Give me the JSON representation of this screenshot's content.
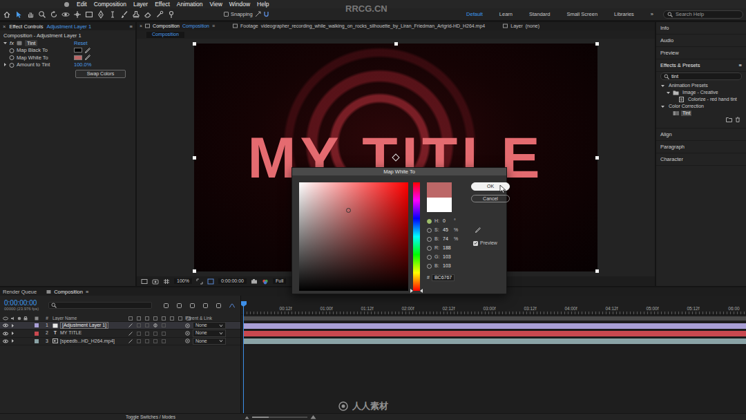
{
  "watermark": {
    "top": "RRCG.CN",
    "logo": "人人素材"
  },
  "menu": {
    "items": [
      "Edit",
      "Composition",
      "Layer",
      "Effect",
      "Animation",
      "View",
      "Window",
      "Help"
    ]
  },
  "toolbar": {
    "tools": [
      {
        "selected": false
      },
      {
        "selected": true
      },
      {
        "selected": false
      },
      {
        "selected": false
      },
      {
        "selected": false
      },
      {
        "selected": false
      },
      {
        "selected": false
      },
      {
        "selected": false
      },
      {
        "selected": false
      },
      {
        "selected": false
      },
      {
        "selected": false
      },
      {
        "selected": false
      },
      {
        "selected": false
      },
      {
        "selected": false
      },
      {
        "selected": false
      }
    ],
    "snapping": {
      "label": "Snapping",
      "checked": false
    },
    "workspaces": [
      {
        "label": "Default",
        "selected": true
      },
      {
        "label": "Learn",
        "selected": false
      },
      {
        "label": "Standard",
        "selected": false
      },
      {
        "label": "Small Screen",
        "selected": false
      },
      {
        "label": "Libraries",
        "selected": false
      }
    ],
    "overflow": "»",
    "search": {
      "placeholder": "Search Help"
    }
  },
  "effect_controls": {
    "tab": {
      "close": "×",
      "label": "Effect Controls",
      "layer": "Adjustment Layer 1",
      "menu": "≡"
    },
    "path": "Composition - Adjustment Layer 1",
    "effect": {
      "expanded": true,
      "fx": "fx",
      "name": "Tint",
      "reset": "Reset"
    },
    "params": [
      {
        "kind": "color",
        "label": "Map Black To",
        "color": "#000000"
      },
      {
        "kind": "color",
        "label": "Map White To",
        "color": "#bc6767"
      },
      {
        "kind": "value",
        "label": "Amount to Tint",
        "value": "100.0%",
        "expanded": false
      }
    ],
    "swap_button": "Swap Colors"
  },
  "composition": {
    "tabs": [
      {
        "label": "Composition",
        "name": "Composition",
        "selected": true,
        "close": "×",
        "menu": "≡"
      },
      {
        "label": "Footage",
        "name": "videographer_recording_while_walking_on_rocks_silhouette_by_Liran_Friedman_Artgrid-HD_H264.mp4",
        "selected": false
      },
      {
        "label": "Layer",
        "name": "(none)",
        "selected": false
      }
    ],
    "subtab": "Composition",
    "title_text": "MY TITLE",
    "viewer_bar": {
      "zoom": "100%",
      "time": "0:00:00:00",
      "resolution": "Full"
    }
  },
  "color_dialog": {
    "title": "Map White To",
    "ok": "OK",
    "cancel": "Cancel",
    "new_color": "#bc6767",
    "old_color": "#ffffff",
    "hue_color": "#ff0000",
    "saturation": 0.45,
    "brightness": 0.74,
    "hue_level": 0,
    "fields": [
      {
        "label": "H:",
        "value": "0",
        "unit": "°",
        "selected": true
      },
      {
        "label": "S:",
        "value": "45",
        "unit": "%",
        "selected": false
      },
      {
        "label": "B:",
        "value": "74",
        "unit": "%",
        "selected": false
      },
      {
        "label": "R:",
        "value": "188",
        "selected": false
      },
      {
        "label": "G:",
        "value": "103",
        "selected": false
      },
      {
        "label": "B:",
        "value": "103",
        "selected": false
      }
    ],
    "hex": {
      "label": "#",
      "value": "BC6767"
    },
    "preview": {
      "label": "Preview",
      "checked": true
    }
  },
  "side_panels": {
    "top": [
      "Info",
      "Audio",
      "Preview"
    ],
    "effects": {
      "title": "Effects & Presets",
      "menu": "≡",
      "search": "tint",
      "tree": [
        {
          "label": "Animation Presets",
          "kind": "group",
          "depth": 0,
          "expanded": true,
          "selected": false
        },
        {
          "label": "Image - Creative",
          "kind": "folder",
          "depth": 1,
          "expanded": true,
          "selected": false
        },
        {
          "label": "Colorize - red hand tint",
          "kind": "preset",
          "depth": 2,
          "expanded": false,
          "selected": false
        },
        {
          "label": "Color Correction",
          "kind": "group",
          "depth": 0,
          "expanded": true,
          "selected": false
        },
        {
          "label": "Tint",
          "kind": "effect",
          "depth": 1,
          "expanded": false,
          "selected": true
        }
      ]
    },
    "bottom": [
      "Align",
      "Paragraph",
      "Character"
    ]
  },
  "timeline": {
    "tabs": [
      {
        "label": "Render Queue",
        "selected": false
      },
      {
        "label": "Composition",
        "selected": true,
        "menu": "≡"
      }
    ],
    "timecode": "0:00:00:00",
    "frame_info": "00000 (23.976 fps)",
    "columns": {
      "number": "#",
      "name": "Layer Name",
      "parent": "Parent & Link"
    },
    "layers": [
      {
        "number": "1",
        "name": "[Adjustment Layer 1]",
        "kind": "adjustment",
        "color": "#a99fd6",
        "selected": true,
        "visible": true,
        "parent": "None"
      },
      {
        "number": "2",
        "name": "MY TITLE",
        "kind": "text",
        "glyph": "T",
        "color": "#c9484f",
        "selected": false,
        "visible": true,
        "parent": "None"
      },
      {
        "number": "3",
        "name": "[speedb...HD_H264.mp4]",
        "kind": "footage",
        "color": "#8aa3a6",
        "selected": false,
        "visible": true,
        "parent": "None"
      }
    ],
    "ruler": [
      "00:12f",
      "01:00f",
      "01:12f",
      "02:00f",
      "02:12f",
      "03:00f",
      "03:12f",
      "04:00f",
      "04:12f",
      "05:00f",
      "05:12f",
      "06:00"
    ],
    "playhead": 0,
    "zoom_level": 0.3,
    "footer": "Toggle Switches / Modes"
  }
}
